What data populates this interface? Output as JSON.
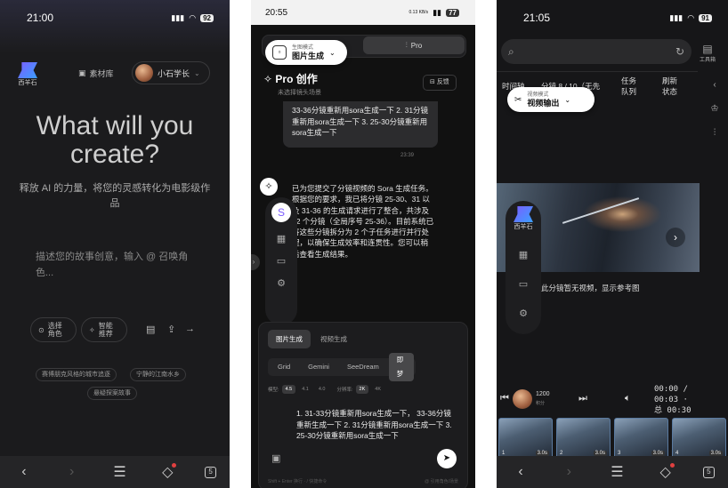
{
  "colors": {
    "bg_dark": "#1b1b1d",
    "accent_blue": "#3aa0ff",
    "accent_purple": "#7c5cff",
    "notif_red": "#e04040"
  },
  "p1": {
    "status": {
      "time": "21:00",
      "battery": "92"
    },
    "logo_text": "西羊石",
    "material_label": "素材库",
    "user_name": "小石学长",
    "hero": "What will you create?",
    "subtitle": "释放 AI 的力量，将您的灵感转化为电影级作品",
    "prompt_placeholder": "描述您的故事创意，输入 @ 召唤角色...",
    "chip_role": "选择\n角色",
    "chip_smart": "智能\n推荐",
    "tags": [
      "赛博朋克风格的城市追逐",
      "宁静的江南水乡",
      "悬疑探案故事"
    ],
    "nav_tab_num": "5"
  },
  "p2": {
    "status": {
      "time": "20:55",
      "battery": "77",
      "net": "0.13 KB/s"
    },
    "mode_small": "生图模式",
    "mode_big": "图片生成",
    "pro_tab": "Pro",
    "pro_title": "Pro 创作",
    "pro_sub": "未选择镜头场景",
    "feedback": "反馈",
    "bubble_text": "33-36分镜重新用sora生成一下 2. 31分镜重新用sora生成一下 3. 25-30分镜重新用sora生成一下",
    "time": "23:39",
    "ai_msg": "已为您提交了分镜视频的 Sora 生成任务。根据您的要求，我已将分镜 25-30、31 以及 31-36 的生成请求进行了整合，共涉及 12 个分镜（全局序号 25-36）。目前系统已将这些分镜拆分为 2 个子任务进行并行处理，以确保生成效率和连贯性。您可以稍后查看生成结果。",
    "tabs": [
      "图片生成",
      "视频生成"
    ],
    "models": [
      "Grid",
      "Gemini",
      "SeeDream",
      "即梦"
    ],
    "model_label": "模型:",
    "model_opts": [
      "4.5",
      "4.1",
      "4.0"
    ],
    "res_label": "分辨率:",
    "res_opts": [
      "2K",
      "4K"
    ],
    "input_text": "1. 31-33分镜重新用sora生成一下， 33-36分镜重新生成一下 2. 31分镜重新用sora生成一下 3. 25-30分镜重新用sora生成一下",
    "hint_left": "Shift + Enter 换行 · / 快捷命令",
    "hint_right": "@ 引用角色/场景"
  },
  "p3": {
    "status": {
      "time": "21:05",
      "battery": "91"
    },
    "toolbox": "工具箱",
    "col_time": "时间轴",
    "col_shot": "分镜 8 / 10（无先",
    "task_queue": "任务\n队列",
    "refresh": "刷新\n状态",
    "mode_small": "视频模式",
    "mode_big": "视频输出",
    "caption": "此分镜暂无视频，显示参考图",
    "logo_text": "西羊石",
    "credits": "1200",
    "credits_label": "积分",
    "time_cur": "00:00 /",
    "time_tot": "00:03 ·",
    "total": "总 00:30",
    "thumbs": [
      {
        "n": "1",
        "d": "3.0s"
      },
      {
        "n": "2",
        "d": "3.0s"
      },
      {
        "n": "3",
        "d": "3.0s"
      },
      {
        "n": "4",
        "d": "3.0s"
      }
    ]
  }
}
